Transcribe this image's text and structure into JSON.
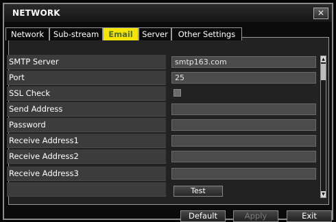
{
  "window": {
    "title": "NETWORK",
    "close_glyph": "✕"
  },
  "tabs": [
    {
      "label": "Network",
      "active": false
    },
    {
      "label": "Sub-stream",
      "active": false
    },
    {
      "label": "Email",
      "active": true
    },
    {
      "label": "Server",
      "active": false
    },
    {
      "label": "Other Settings",
      "active": false
    }
  ],
  "email_settings": {
    "rows": [
      {
        "label": "SMTP Server",
        "value": "smtp163.com"
      },
      {
        "label": "Port",
        "value": "25"
      },
      {
        "label": "SSL Check",
        "checked": false
      },
      {
        "label": "Send Address",
        "value": ""
      },
      {
        "label": "Password",
        "value": ""
      },
      {
        "label": "Receive Address1",
        "value": ""
      },
      {
        "label": "Receive Address2",
        "value": ""
      },
      {
        "label": "Receive Address3",
        "value": ""
      }
    ],
    "test_label": "Test"
  },
  "footer": {
    "default_label": "Default",
    "apply_label": "Apply",
    "exit_label": "Exit",
    "apply_enabled": false
  },
  "icons": {
    "close": "close-icon",
    "scroll_up": "arrow-up-icon",
    "scroll_down": "arrow-down-icon"
  },
  "colors": {
    "active_tab": "#f5e400",
    "active_tab_text": "#4d6a2a",
    "panel_bg": "#222222"
  }
}
